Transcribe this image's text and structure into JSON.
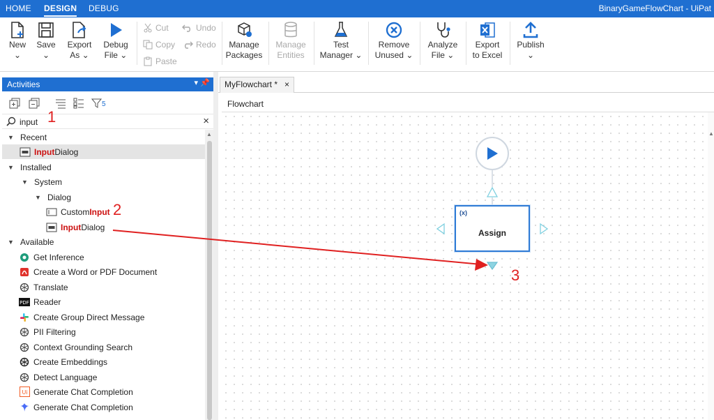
{
  "menu": {
    "home": "HOME",
    "design": "DESIGN",
    "debug": "DEBUG",
    "title": "BinaryGameFlowChart - UiPat"
  },
  "ribbon": {
    "new_l1": "New",
    "save_l1": "Save",
    "export_l1": "Export",
    "export_l2": "As",
    "debug_l1": "Debug",
    "debug_l2": "File",
    "cut": "Cut",
    "copy": "Copy",
    "paste": "Paste",
    "undo": "Undo",
    "redo": "Redo",
    "manage_l1": "Manage",
    "manage_l2": "Packages",
    "entities_l1": "Manage",
    "entities_l2": "Entities",
    "test_l1": "Test",
    "test_l2": "Manager",
    "remove_l1": "Remove",
    "remove_l2": "Unused",
    "analyze_l1": "Analyze",
    "analyze_l2": "File",
    "excel_l1": "Export",
    "excel_l2": "to Excel",
    "publish_l1": "Publish"
  },
  "activities": {
    "header": "Activities",
    "filter_count": "5",
    "search_value": "input",
    "groups": {
      "recent": "Recent",
      "installed": "Installed",
      "system": "System",
      "dialog": "Dialog",
      "available": "Available"
    },
    "recent_item": {
      "hl": "Input",
      "rest": " Dialog"
    },
    "custom_input": {
      "pre": "Custom ",
      "hl": "Input"
    },
    "input_dialog": {
      "hl": "Input",
      "rest": " Dialog"
    },
    "available_items": [
      "Get Inference",
      "Create a Word or PDF Document",
      "Translate",
      "Reader",
      "Create Group Direct Message",
      "PII Filtering",
      "Context Grounding Search",
      "Create Embeddings",
      "Detect Language",
      "Generate Chat Completion",
      "Generate Chat Completion"
    ],
    "reader_icon_text": "PDF"
  },
  "canvas": {
    "tab": "MyFlowchart *",
    "tab_close": "×",
    "breadcrumb": "Flowchart",
    "assign_label": "Assign",
    "assign_icon_text": "(x)"
  },
  "annotations": {
    "n1": "1",
    "n2": "2",
    "n3": "3"
  },
  "colors": {
    "accent": "#1f6fd1",
    "highlight": "#cc1111",
    "annotation": "#e02020",
    "selected_node": "#2e7bd6"
  }
}
